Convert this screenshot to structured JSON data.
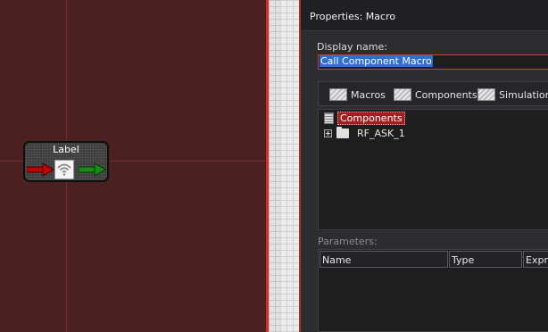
{
  "canvas": {
    "block": {
      "label": "Label"
    }
  },
  "panel": {
    "title": "Properties: Macro",
    "display_name": {
      "label": "Display name:",
      "value": "Call Component Macro"
    },
    "tabs": [
      {
        "label": "Macros",
        "icon": "macros-icon"
      },
      {
        "label": "Components",
        "icon": "components-icon"
      },
      {
        "label": "Simulation",
        "icon": "simulation-icon"
      }
    ],
    "tree": {
      "root": "Components",
      "children": [
        {
          "label": "RF_ASK_1"
        }
      ]
    },
    "parameters": {
      "label": "Parameters:",
      "columns": [
        "Name",
        "Type",
        "Expre"
      ]
    }
  },
  "colors": {
    "canvas_background": "#4a2020",
    "selection_red": "#a31f1f",
    "input_highlight": "#2e6fcf",
    "arrow_in": "#c00000",
    "arrow_out": "#1a8a1a"
  }
}
